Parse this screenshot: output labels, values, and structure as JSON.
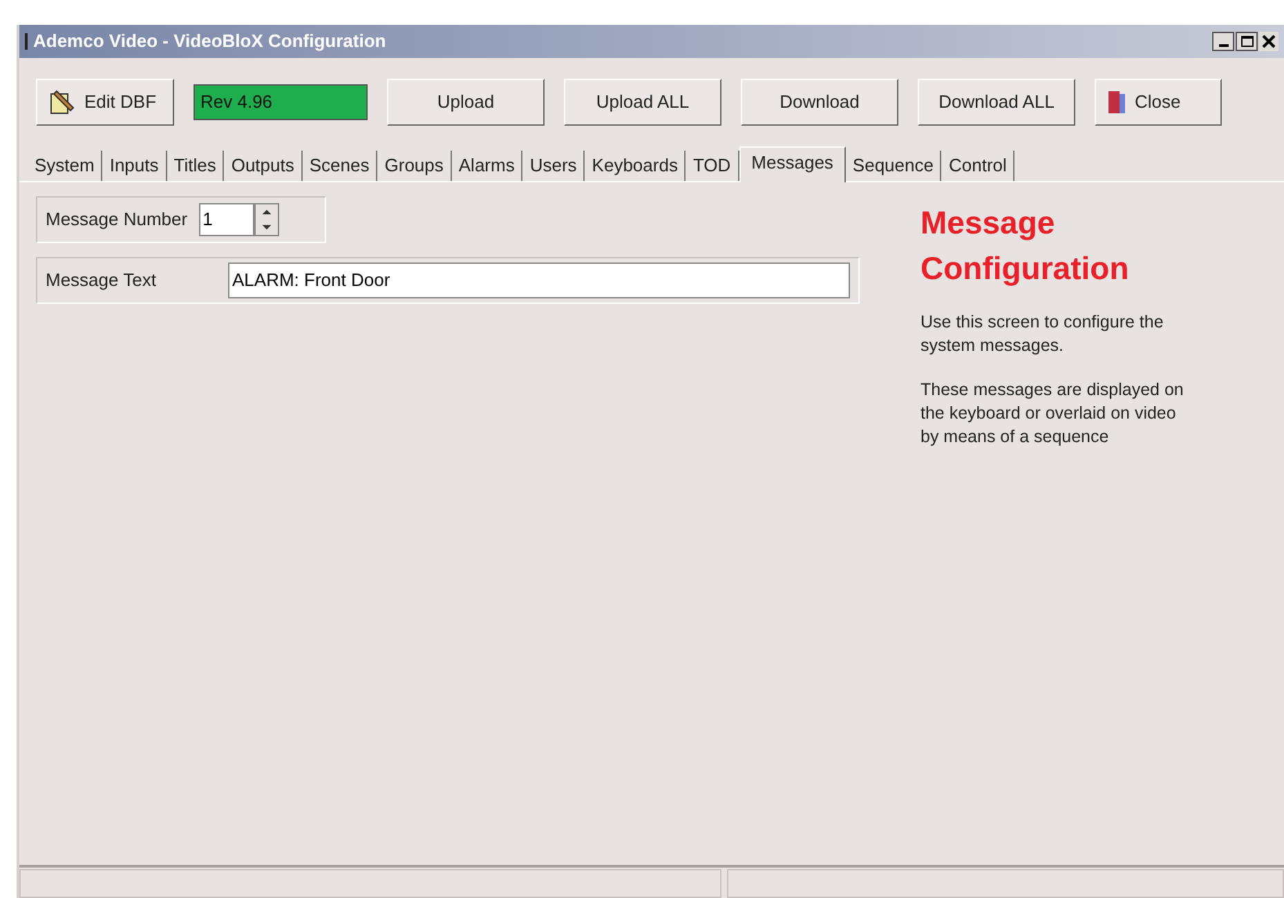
{
  "window": {
    "title": "Ademco Video - VideoBloX Configuration"
  },
  "toolbar": {
    "buttons": [
      {
        "label": "Edit DBF",
        "kind": "icon"
      },
      {
        "label": "Rev 4.96",
        "kind": "status"
      },
      {
        "label": "Upload",
        "kind": "plain"
      },
      {
        "label": "Upload ALL",
        "kind": "plain"
      },
      {
        "label": "Download",
        "kind": "plain"
      },
      {
        "label": "Download ALL",
        "kind": "plain"
      },
      {
        "label": "Close",
        "kind": "close"
      }
    ]
  },
  "tabs": [
    {
      "label": "System",
      "selected": false
    },
    {
      "label": "Inputs",
      "selected": false
    },
    {
      "label": "Titles",
      "selected": false
    },
    {
      "label": "Outputs",
      "selected": false
    },
    {
      "label": "Scenes",
      "selected": false
    },
    {
      "label": "Groups",
      "selected": false
    },
    {
      "label": "Alarms",
      "selected": false
    },
    {
      "label": "Users",
      "selected": false
    },
    {
      "label": "Keyboards",
      "selected": false
    },
    {
      "label": "TOD",
      "selected": false
    },
    {
      "label": "Messages",
      "selected": true
    },
    {
      "label": "Sequence",
      "selected": false
    },
    {
      "label": "Control",
      "selected": false
    }
  ],
  "form": {
    "message_number": {
      "label": "Message Number",
      "value": "1"
    },
    "message_text": {
      "label": "Message Text",
      "value": "ALARM: Front Door"
    }
  },
  "help": {
    "heading": "Message Configuration",
    "paragraphs": [
      "Use this screen to configure the system messages.",
      "These messages are displayed on the keyboard or overlaid on video by means of a sequence"
    ]
  }
}
